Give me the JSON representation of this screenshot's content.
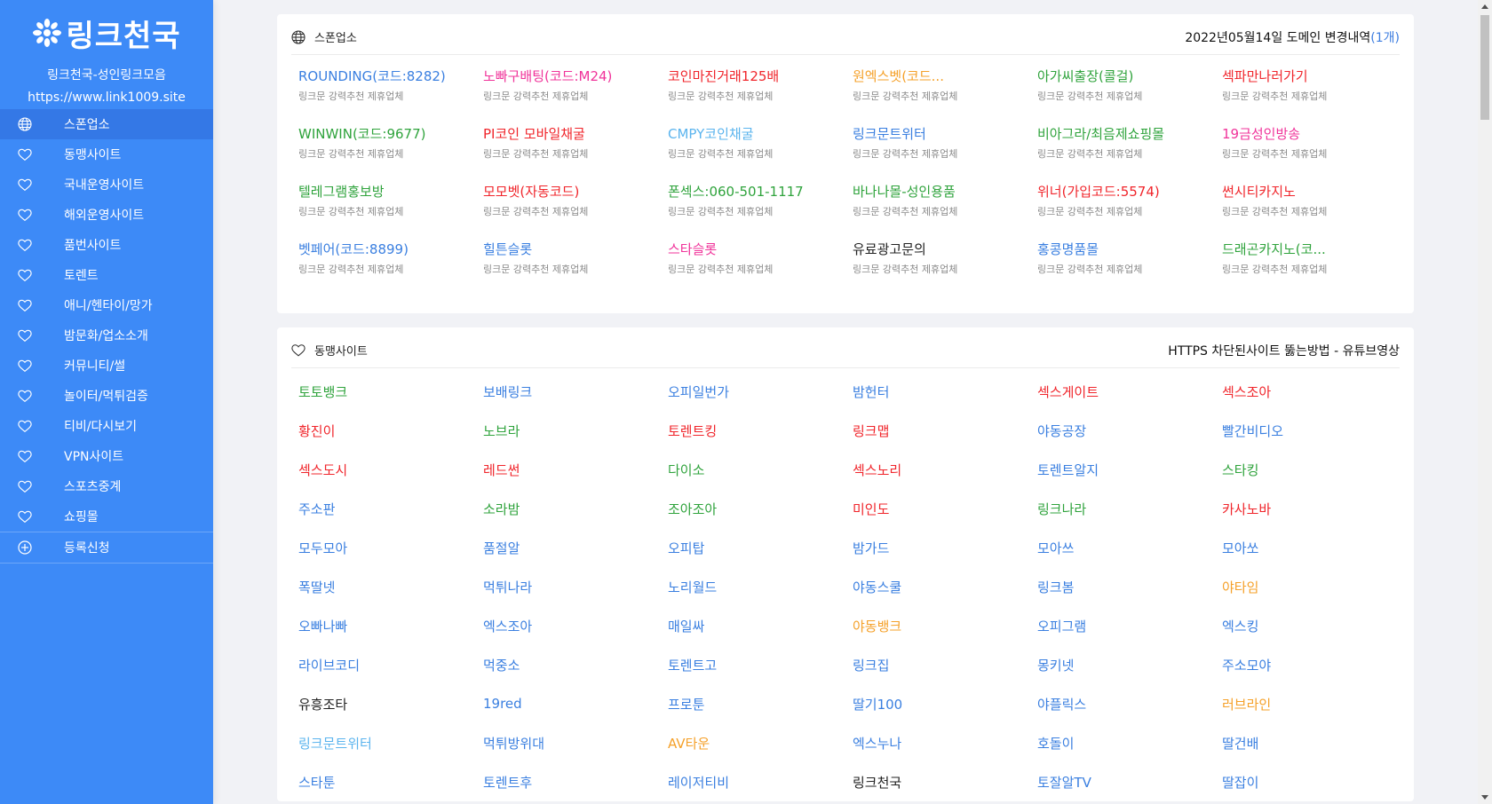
{
  "sidebar": {
    "logo_text": "링크천국",
    "subtitle": "링크천국-성인링크모음",
    "url": "https://www.link1009.site",
    "items": [
      {
        "label": "스폰업소",
        "icon": "globe-icon",
        "active": true
      },
      {
        "label": "동맹사이트",
        "icon": "heart-icon"
      },
      {
        "label": "국내운영사이트",
        "icon": "heart-icon"
      },
      {
        "label": "해외운영사이트",
        "icon": "heart-icon"
      },
      {
        "label": "품번사이트",
        "icon": "heart-icon"
      },
      {
        "label": "토렌트",
        "icon": "heart-icon"
      },
      {
        "label": "애니/헨타이/망가",
        "icon": "heart-icon"
      },
      {
        "label": "밤문화/업소소개",
        "icon": "heart-icon"
      },
      {
        "label": "커뮤니티/썰",
        "icon": "heart-icon"
      },
      {
        "label": "놀이터/먹튀검증",
        "icon": "heart-icon"
      },
      {
        "label": "티비/다시보기",
        "icon": "heart-icon"
      },
      {
        "label": "VPN사이트",
        "icon": "heart-icon"
      },
      {
        "label": "스포츠중계",
        "icon": "heart-icon"
      },
      {
        "label": "쇼핑몰",
        "icon": "heart-icon"
      }
    ],
    "register": {
      "label": "등록신청",
      "icon": "plus-circle-icon"
    }
  },
  "colors": {
    "sidebar_bg": "#3d8af7",
    "blue": "#3a7fe0",
    "red": "#f0252b",
    "green": "#2fa33c",
    "orange": "#f5a12a",
    "pink": "#f0339a",
    "lightblue": "#5bb4ee",
    "black": "#222222"
  },
  "sponsor": {
    "title": "스폰업소",
    "icon": "globe-icon",
    "right_text": "2022년05월14일 도메인 변경내역",
    "right_count": "(1개)",
    "items": [
      {
        "name": "ROUNDING(코드:8282)",
        "color": "blue",
        "desc": "링크문 강력추천 제휴업체"
      },
      {
        "name": "노빠구배팅(코드:M24)",
        "color": "pink",
        "desc": "링크문 강력추천 제휴업체"
      },
      {
        "name": "코인마진거래125배",
        "color": "red",
        "desc": "링크문 강력추천 제휴업체"
      },
      {
        "name": "원엑스벳(코드...",
        "color": "orange",
        "desc": "링크문 강력추천 제휴업체"
      },
      {
        "name": "아가씨출장(콜걸)",
        "color": "green",
        "desc": "링크문 강력추천 제휴업체"
      },
      {
        "name": "섹파만나러가기",
        "color": "red",
        "desc": "링크문 강력추천 제휴업체"
      },
      {
        "name": "WINWIN(코드:9677)",
        "color": "green",
        "desc": "링크문 강력추천 제휴업체"
      },
      {
        "name": "PI코인 모바일채굴",
        "color": "red",
        "desc": "링크문 강력추천 제휴업체"
      },
      {
        "name": "CMPY코인채굴",
        "color": "lightblue",
        "desc": "링크문 강력추천 제휴업체"
      },
      {
        "name": "링크문트위터",
        "color": "blue",
        "desc": "링크문 강력추천 제휴업체"
      },
      {
        "name": "비아그라/최음제쇼핑몰",
        "color": "green",
        "desc": "링크문 강력추천 제휴업체"
      },
      {
        "name": "19금성인방송",
        "color": "pink",
        "desc": "링크문 강력추천 제휴업체"
      },
      {
        "name": "텔레그램홍보방",
        "color": "green",
        "desc": "링크문 강력추천 제휴업체"
      },
      {
        "name": "모모벳(자동코드)",
        "color": "red",
        "desc": "링크문 강력추천 제휴업체"
      },
      {
        "name": "폰섹스:060-501-1117",
        "color": "green",
        "desc": "링크문 강력추천 제휴업체"
      },
      {
        "name": "바나나몰-성인용품",
        "color": "green",
        "desc": "링크문 강력추천 제휴업체"
      },
      {
        "name": "위너(가입코드:5574)",
        "color": "red",
        "desc": "링크문 강력추천 제휴업체"
      },
      {
        "name": "썬시티카지노",
        "color": "red",
        "desc": "링크문 강력추천 제휴업체"
      },
      {
        "name": "벳페어(코드:8899)",
        "color": "blue",
        "desc": "링크문 강력추천 제휴업체"
      },
      {
        "name": "힐튼슬롯",
        "color": "blue",
        "desc": "링크문 강력추천 제휴업체"
      },
      {
        "name": "스타슬롯",
        "color": "pink",
        "desc": "링크문 강력추천 제휴업체"
      },
      {
        "name": "유료광고문의",
        "color": "black",
        "desc": "링크문 강력추천 제휴업체"
      },
      {
        "name": "홍콩명품몰",
        "color": "blue",
        "desc": "링크문 강력추천 제휴업체"
      },
      {
        "name": "드래곤카지노(코...",
        "color": "green",
        "desc": "링크문 강력추천 제휴업체"
      }
    ]
  },
  "alliance": {
    "title": "동맹사이트",
    "icon": "heart-icon",
    "right_text": "HTTPS 차단된사이트 뚫는방법 - 유튜브영상",
    "items": [
      {
        "name": "토토뱅크",
        "color": "green"
      },
      {
        "name": "보배링크",
        "color": "blue"
      },
      {
        "name": "오피일번가",
        "color": "blue"
      },
      {
        "name": "밤헌터",
        "color": "blue"
      },
      {
        "name": "섹스게이트",
        "color": "red"
      },
      {
        "name": "섹스조아",
        "color": "red"
      },
      {
        "name": "황진이",
        "color": "red"
      },
      {
        "name": "노브라",
        "color": "green"
      },
      {
        "name": "토렌트킹",
        "color": "red"
      },
      {
        "name": "링크맵",
        "color": "red"
      },
      {
        "name": "야동공장",
        "color": "blue"
      },
      {
        "name": "빨간비디오",
        "color": "blue"
      },
      {
        "name": "섹스도시",
        "color": "red"
      },
      {
        "name": "레드썬",
        "color": "red"
      },
      {
        "name": "다이소",
        "color": "green"
      },
      {
        "name": "섹스노리",
        "color": "red"
      },
      {
        "name": "토렌트알지",
        "color": "blue"
      },
      {
        "name": "스타킹",
        "color": "green"
      },
      {
        "name": "주소판",
        "color": "blue"
      },
      {
        "name": "소라밤",
        "color": "green"
      },
      {
        "name": "조아조아",
        "color": "green"
      },
      {
        "name": "미인도",
        "color": "red"
      },
      {
        "name": "링크나라",
        "color": "green"
      },
      {
        "name": "카사노바",
        "color": "red"
      },
      {
        "name": "모두모아",
        "color": "blue"
      },
      {
        "name": "품절알",
        "color": "blue"
      },
      {
        "name": "오피탑",
        "color": "blue"
      },
      {
        "name": "밤가드",
        "color": "blue"
      },
      {
        "name": "모아쓰",
        "color": "blue"
      },
      {
        "name": "모아쏘",
        "color": "blue"
      },
      {
        "name": "폭딸넷",
        "color": "blue"
      },
      {
        "name": "먹튀나라",
        "color": "blue"
      },
      {
        "name": "노리월드",
        "color": "blue"
      },
      {
        "name": "야동스쿨",
        "color": "blue"
      },
      {
        "name": "링크봄",
        "color": "blue"
      },
      {
        "name": "야타임",
        "color": "orange"
      },
      {
        "name": "오빠나빠",
        "color": "blue"
      },
      {
        "name": "엑스조아",
        "color": "blue"
      },
      {
        "name": "매일싸",
        "color": "blue"
      },
      {
        "name": "야동뱅크",
        "color": "orange"
      },
      {
        "name": "오피그램",
        "color": "blue"
      },
      {
        "name": "엑스킹",
        "color": "blue"
      },
      {
        "name": "라이브코디",
        "color": "blue"
      },
      {
        "name": "먹중소",
        "color": "blue"
      },
      {
        "name": "토렌트고",
        "color": "blue"
      },
      {
        "name": "링크집",
        "color": "blue"
      },
      {
        "name": "몽키넷",
        "color": "blue"
      },
      {
        "name": "주소모야",
        "color": "blue"
      },
      {
        "name": "유흥조타",
        "color": "black"
      },
      {
        "name": "19red",
        "color": "blue"
      },
      {
        "name": "프로툰",
        "color": "blue"
      },
      {
        "name": "딸기100",
        "color": "blue"
      },
      {
        "name": "야플릭스",
        "color": "blue"
      },
      {
        "name": "러브라인",
        "color": "orange"
      },
      {
        "name": "링크문트위터",
        "color": "lightblue"
      },
      {
        "name": "먹튀방위대",
        "color": "blue"
      },
      {
        "name": "AV타운",
        "color": "orange"
      },
      {
        "name": "엑스누나",
        "color": "blue"
      },
      {
        "name": "호돌이",
        "color": "blue"
      },
      {
        "name": "딸건배",
        "color": "blue"
      },
      {
        "name": "스타툰",
        "color": "blue"
      },
      {
        "name": "토렌트후",
        "color": "blue"
      },
      {
        "name": "레이저티비",
        "color": "blue"
      },
      {
        "name": "링크천국",
        "color": "black"
      },
      {
        "name": "토잘알TV",
        "color": "blue"
      },
      {
        "name": "딸잡이",
        "color": "blue"
      }
    ]
  }
}
